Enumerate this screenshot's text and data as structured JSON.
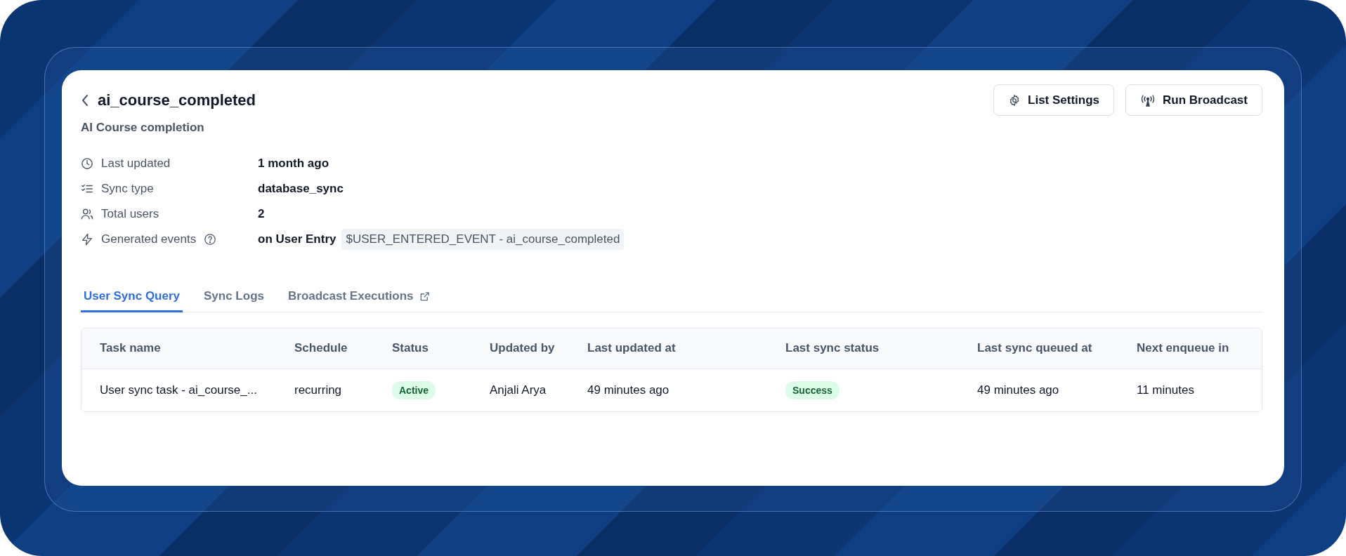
{
  "header": {
    "title": "ai_course_completed",
    "subtitle": "AI Course completion",
    "buttons": [
      {
        "label": "List Settings"
      },
      {
        "label": "Run Broadcast"
      }
    ]
  },
  "details": [
    {
      "label": "Last updated",
      "value": "1 month ago"
    },
    {
      "label": "Sync type",
      "value": "database_sync"
    },
    {
      "label": "Total users",
      "value": "2"
    },
    {
      "label": "Generated events",
      "help": true,
      "value": "on User Entry",
      "code": "$USER_ENTERED_EVENT - ai_course_completed"
    }
  ],
  "tabs": [
    {
      "label": "User Sync Query",
      "selected": true,
      "external": false
    },
    {
      "label": "Sync Logs",
      "selected": false,
      "external": false
    },
    {
      "label": "Broadcast Executions",
      "selected": false,
      "external": true
    }
  ],
  "table": {
    "columns": [
      "Task name",
      "Schedule",
      "Status",
      "Updated by",
      "Last updated at",
      "Last sync status",
      "Last sync queued at",
      "Next enqueue in"
    ],
    "rows": [
      {
        "cells": [
          {
            "kind": "text",
            "text": "User sync task - ai_course_..."
          },
          {
            "kind": "text",
            "text": "recurring"
          },
          {
            "kind": "badge",
            "text": "Active"
          },
          {
            "kind": "text",
            "text": "Anjali Arya"
          },
          {
            "kind": "text",
            "text": "49 minutes ago"
          },
          {
            "kind": "badge",
            "text": "Success"
          },
          {
            "kind": "text",
            "text": "49 minutes ago"
          },
          {
            "kind": "text",
            "text": "11 minutes"
          }
        ]
      }
    ]
  }
}
